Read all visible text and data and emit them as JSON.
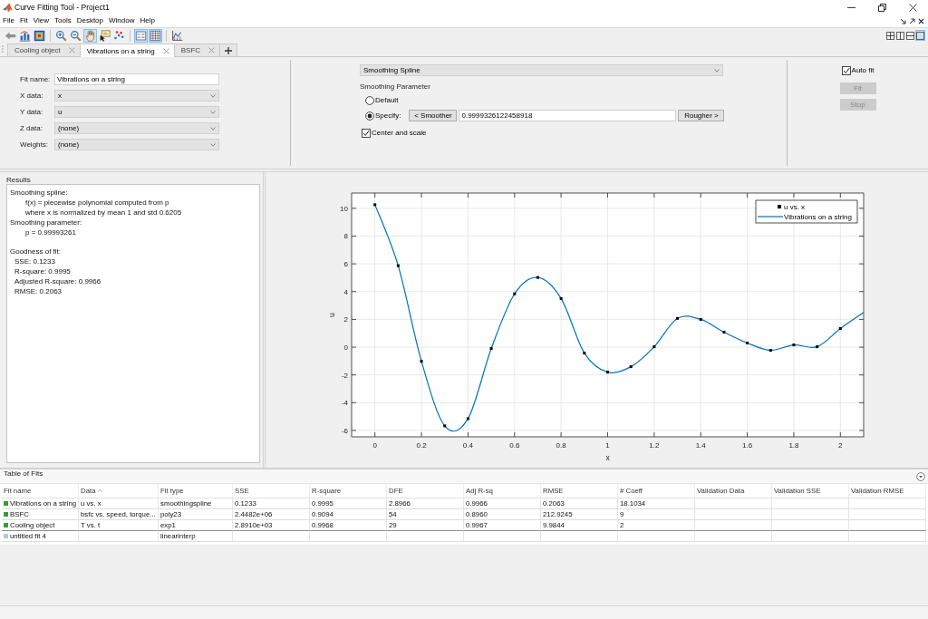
{
  "window": {
    "title": "Curve Fitting Tool - Project1"
  },
  "menu_bar": [
    "File",
    "Fit",
    "View",
    "Tools",
    "Desktop",
    "Window",
    "Help"
  ],
  "toolbar": {
    "groups": [
      [
        {
          "kind": "back",
          "pressed": false
        },
        {
          "kind": "data",
          "pressed": false
        },
        {
          "kind": "colormap",
          "pressed": false
        }
      ],
      [
        {
          "kind": "zoom-in",
          "pressed": false
        },
        {
          "kind": "zoom-out",
          "pressed": false
        },
        {
          "kind": "pan",
          "pressed": true
        },
        {
          "kind": "data-cursor",
          "pressed": false
        },
        {
          "kind": "exclude",
          "pressed": false
        }
      ],
      [
        {
          "kind": "legend",
          "pressed": true
        },
        {
          "kind": "grid",
          "pressed": true
        }
      ],
      [
        {
          "kind": "residuals",
          "pressed": false
        }
      ]
    ],
    "layouts": [
      {
        "kind": "grid",
        "selected": false
      },
      {
        "kind": "columns",
        "selected": false
      },
      {
        "kind": "rows",
        "selected": false
      },
      {
        "kind": "single",
        "selected": true
      }
    ]
  },
  "tabs": [
    {
      "label": "Cooling object",
      "selected": false
    },
    {
      "label": "Vibrations on a string",
      "selected": true
    },
    {
      "label": "BSFC",
      "selected": false
    }
  ],
  "fit_panel": {
    "fields": [
      {
        "label": "Fit name:",
        "kind": "text",
        "value": "Vibrations on a string"
      },
      {
        "label": "X data:",
        "kind": "dropdown",
        "value": "x"
      },
      {
        "label": "Y data:",
        "kind": "dropdown",
        "value": "u"
      },
      {
        "label": "Z data:",
        "kind": "dropdown",
        "value": "(none)"
      },
      {
        "label": "Weights:",
        "kind": "dropdown",
        "value": "(none)"
      }
    ],
    "fit_type": "Smoothing Spline",
    "parameter_title": "Smoothing Parameter",
    "parameter_options": [
      {
        "label": "Default",
        "selected": false
      },
      {
        "label": "Specify:",
        "selected": true,
        "smoother_button": "< Smoother",
        "value": "0.9999326122458918",
        "rougher_button": "Rougher >"
      }
    ],
    "center_and_scale": {
      "label": "Center and scale",
      "checked": true
    },
    "auto_fit": {
      "label": "Auto fit",
      "checked": true
    },
    "buttons": [
      {
        "label": "Fit",
        "disabled": true
      },
      {
        "label": "Stop",
        "disabled": true
      }
    ]
  },
  "results": {
    "title": "Results",
    "sections": [
      {
        "text": "Smoothing spline:",
        "kind": "model",
        "children": [
          {
            "text": "f(x) = piecewise polynomial computed from p"
          },
          {
            "text": "where x is normalized by mean 1 and std 0.6205"
          }
        ]
      },
      {
        "text": "Smoothing parameter:",
        "kind": "model",
        "children": [
          {
            "text": "p = 0.99993261"
          }
        ]
      },
      {
        "text": "Goodness of fit:",
        "kind": "statistics",
        "children": [
          {
            "text": "SSE: 0.1233"
          },
          {
            "text": "R-square: 0.9995"
          },
          {
            "text": "Adjusted R-square: 0.9966"
          },
          {
            "text": "RMSE: 0.2063"
          }
        ]
      }
    ]
  },
  "plot": {
    "chart_data": [
      {
        "type": "line",
        "xlabel": "x",
        "ylabel": "u",
        "xlim": [
          -0.1,
          2.1
        ],
        "ylim": [
          -6.46,
          11.1
        ],
        "xticks": [
          0,
          0.2,
          0.4,
          0.6,
          0.8,
          1,
          1.2,
          1.4,
          1.6,
          1.8,
          2
        ],
        "yticks": [
          -6,
          -4,
          -2,
          0,
          2,
          4,
          6,
          8,
          10
        ],
        "grid": true,
        "legend": "upper right",
        "series": [
          {
            "name": "u vs. x",
            "type": "scatter",
            "color": "#000000",
            "x": [
              0,
              0.1,
              0.2,
              0.3,
              0.4,
              0.5,
              0.6,
              0.7,
              0.8,
              0.9,
              1,
              1.1,
              1.2,
              1.3,
              1.4,
              1.5,
              1.6,
              1.7,
              1.8,
              1.9,
              2
            ],
            "values": [
              10.26,
              5.87,
              -1.02,
              -5.67,
              -5.15,
              -0.1,
              3.84,
              5.02,
              3.5,
              -0.43,
              -1.8,
              -1.41,
              0.03,
              2.07,
              2.0,
              1.08,
              0.3,
              -0.23,
              0.16,
              0.03,
              1.34
            ]
          },
          {
            "name": "Vibrations on a string",
            "type": "line",
            "color": "#0072bd",
            "x": [
              0,
              0.1,
              0.2,
              0.3,
              0.4,
              0.5,
              0.6,
              0.7,
              0.8,
              0.9,
              1,
              1.1,
              1.2,
              1.3,
              1.4,
              1.5,
              1.6,
              1.7,
              1.8,
              1.9,
              2,
              2.1
            ],
            "values": [
              10.26,
              5.87,
              -1.02,
              -5.67,
              -5.15,
              -0.1,
              3.84,
              5.02,
              3.5,
              -0.43,
              -1.8,
              -1.41,
              0.03,
              2.07,
              2.0,
              1.08,
              0.3,
              -0.23,
              0.16,
              0.03,
              1.34,
              2.5
            ]
          }
        ]
      }
    ]
  },
  "table_of_fits": {
    "title": "Table of Fits",
    "columns": [
      {
        "label": "Fit name",
        "sorted": false
      },
      {
        "label": "Data",
        "sorted": true
      },
      {
        "label": "Fit type",
        "sorted": false
      },
      {
        "label": "SSE",
        "sorted": false
      },
      {
        "label": "R-square",
        "sorted": false
      },
      {
        "label": "DFE",
        "sorted": false
      },
      {
        "label": "Adj R-sq",
        "sorted": false
      },
      {
        "label": "RMSE",
        "sorted": false
      },
      {
        "label": "# Coeff",
        "sorted": false
      },
      {
        "label": "Validation Data",
        "sorted": false
      },
      {
        "label": "Validation SSE",
        "sorted": false
      },
      {
        "label": "Validation RMSE",
        "sorted": false
      }
    ],
    "rows": [
      {
        "color": "#3a9a3a",
        "cells": [
          "Vibrations on a string",
          "u vs. x",
          "smoothingspline",
          "0.1233",
          "0.9995",
          "2.8966",
          "0.9966",
          "0.2063",
          "18.1034"
        ]
      },
      {
        "color": "#3a9a3a",
        "cells": [
          "BSFC",
          "bsfc vs. speed, torque...",
          "poly23",
          "2.4482e+06",
          "0.9094",
          "54",
          "0.8960",
          "212.9245",
          "9"
        ]
      },
      {
        "color": "#3a9a3a",
        "cells": [
          "Cooling object",
          "T vs. t",
          "exp1",
          "2.8910e+03",
          "0.9968",
          "29",
          "0.9967",
          "9.9844",
          "2"
        ]
      },
      {
        "color": "#b4c4dc",
        "cells": [
          "untitled fit 4",
          null,
          "linearinterp"
        ]
      }
    ]
  }
}
